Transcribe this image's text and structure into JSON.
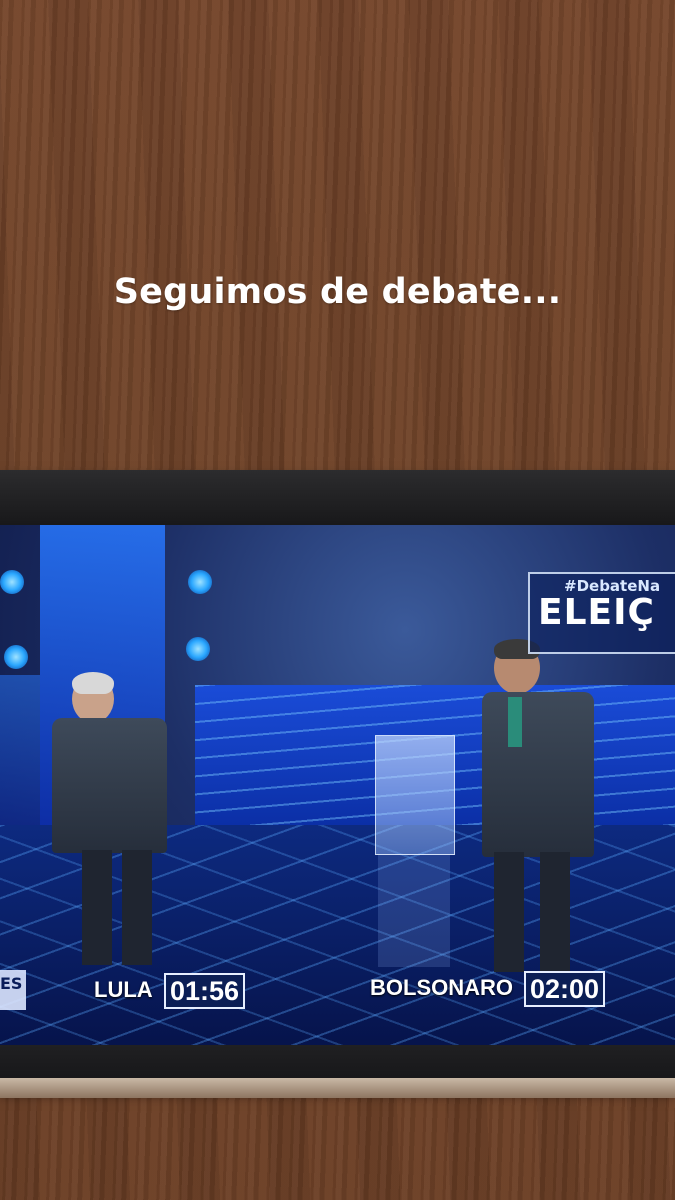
{
  "caption": "Seguimos de debate...",
  "broadcast": {
    "logo_hashtag": "#DebateNa",
    "logo_word": "ELEIÇ",
    "corner_tag": "ES",
    "candidates": [
      {
        "name": "LULA",
        "timer": "01:56"
      },
      {
        "name": "BOLSONARO",
        "timer": "02:00"
      }
    ]
  },
  "colors": {
    "wood": "#6b4128",
    "studio_blue": "#1d2f66",
    "timer_bg": "#0b1e55"
  }
}
